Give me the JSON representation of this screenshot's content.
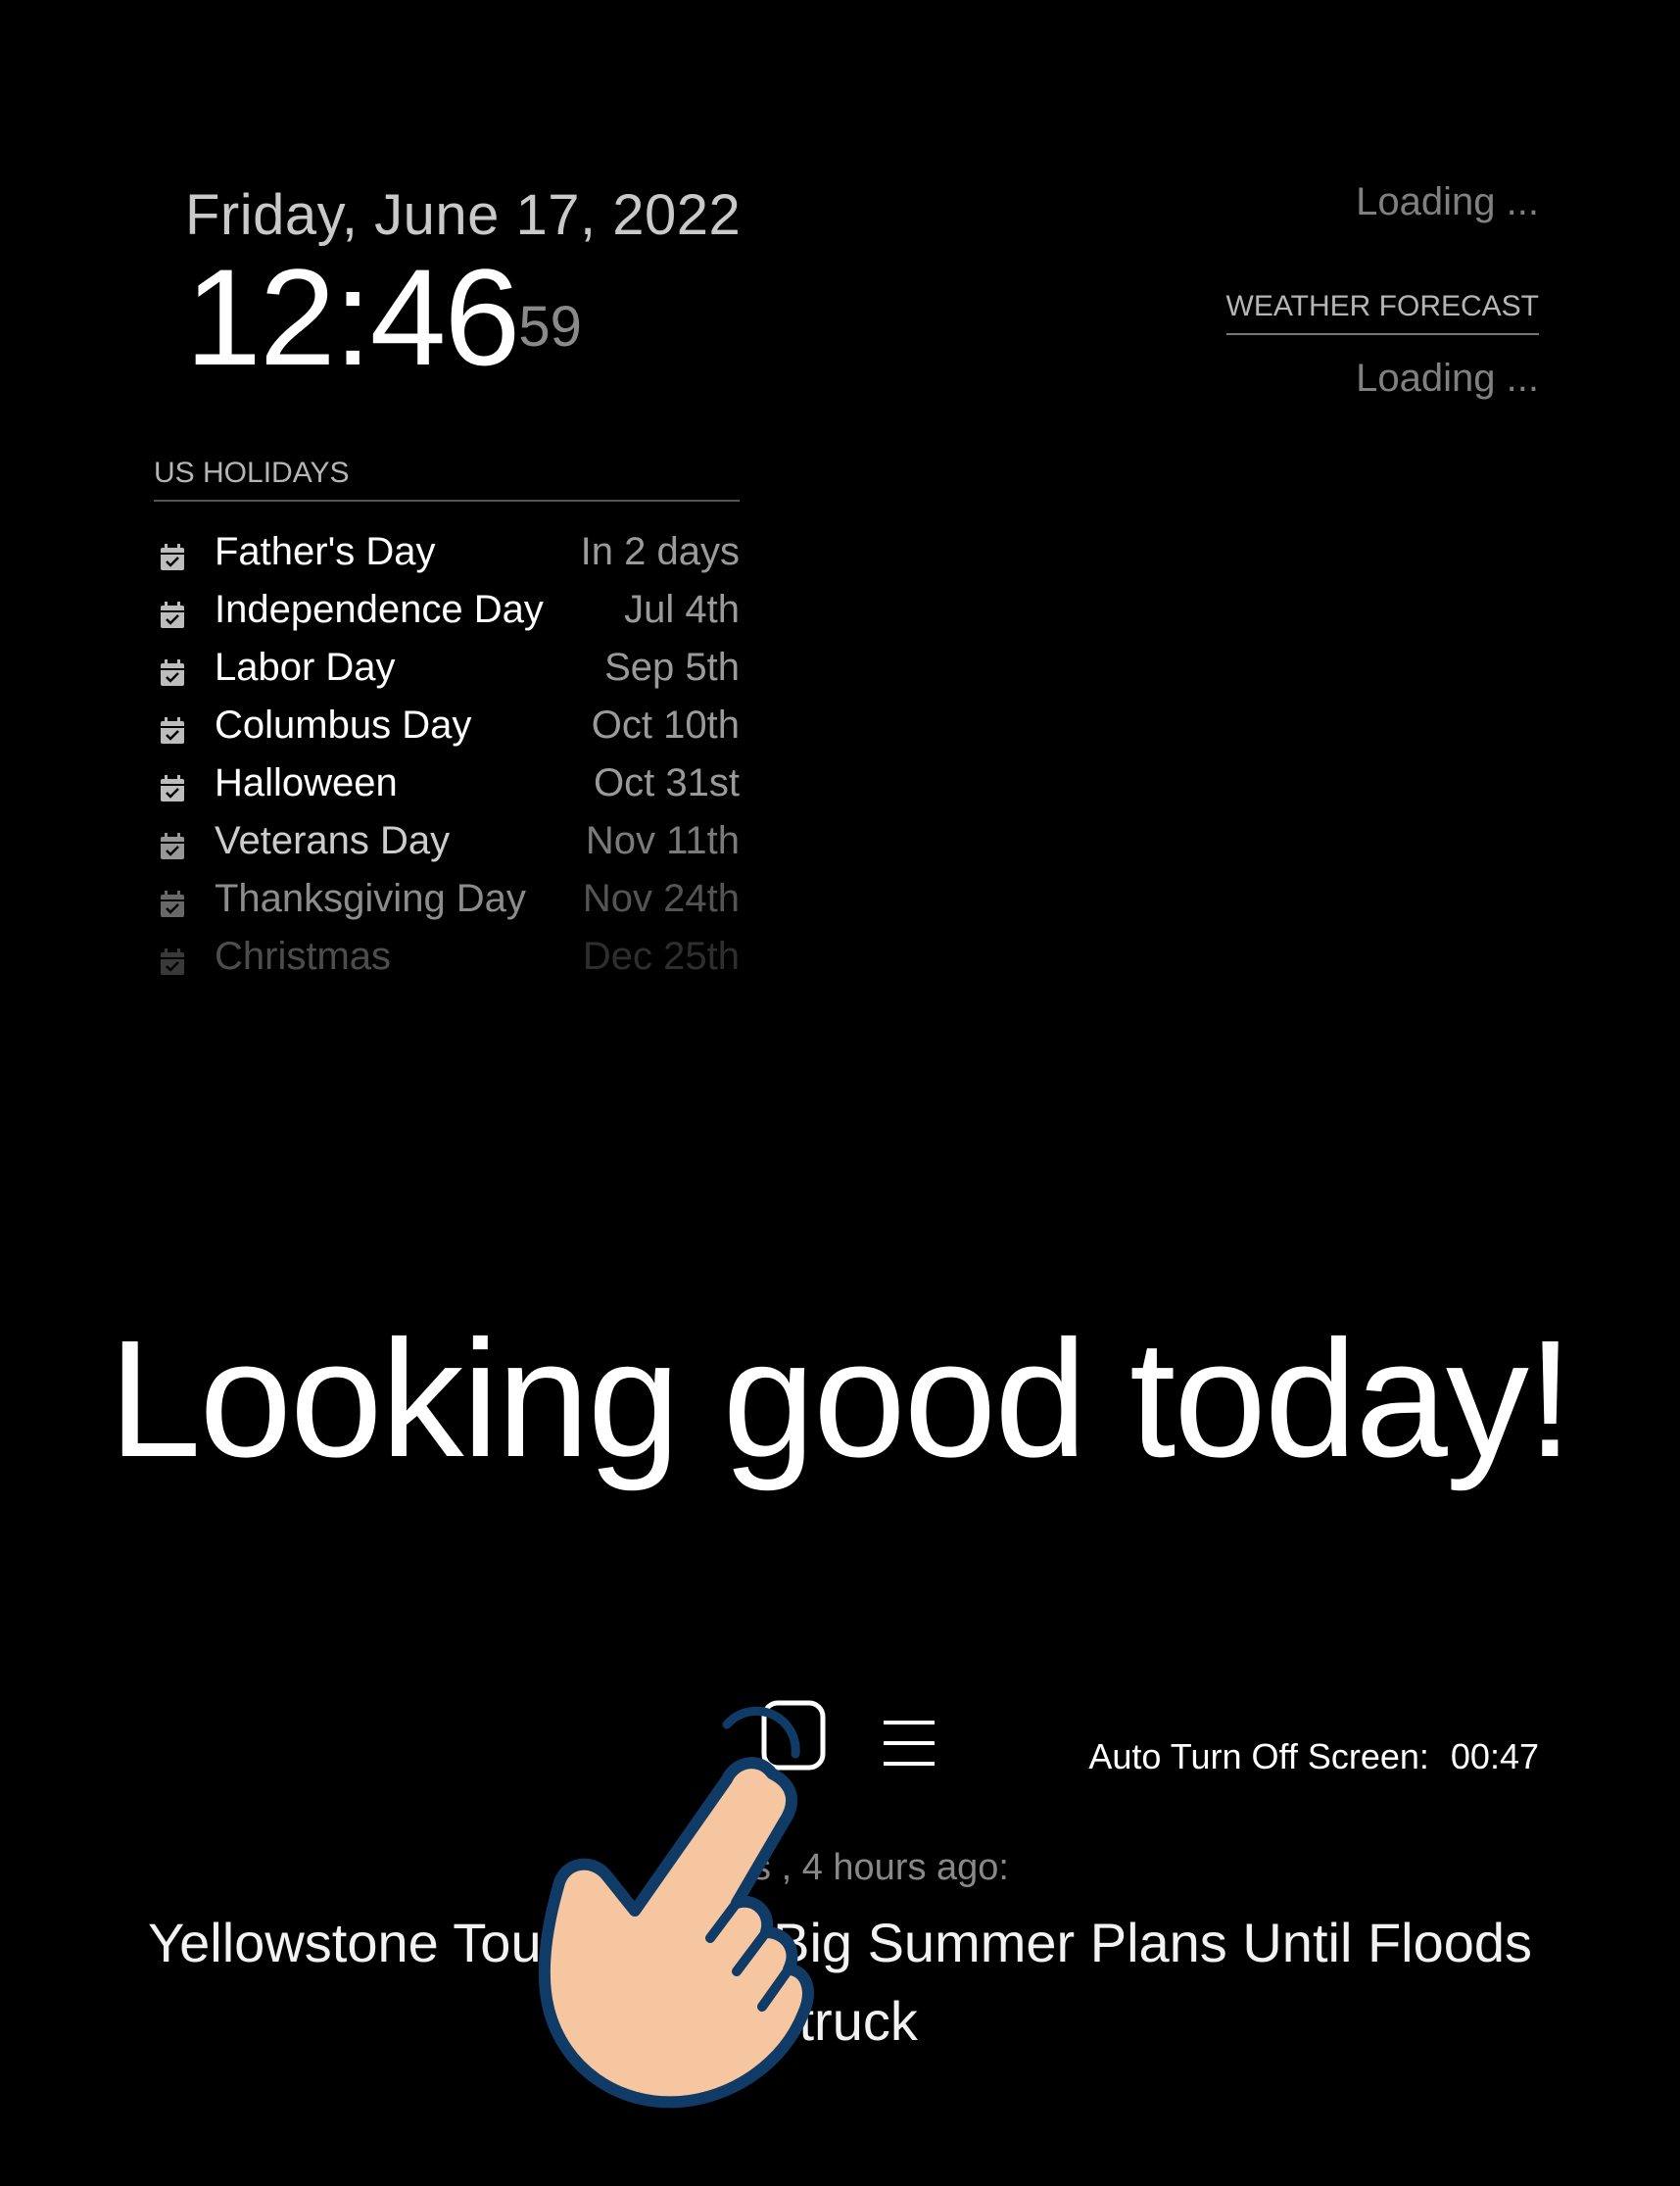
{
  "clock": {
    "date": "Friday, June 17, 2022",
    "time": "12:46",
    "seconds": "59"
  },
  "holidays": {
    "header": "US HOLIDAYS",
    "icon": "calendar-check-icon",
    "events": [
      {
        "title": "Father's Day",
        "time": "In 2 days"
      },
      {
        "title": "Independence Day",
        "time": "Jul 4th"
      },
      {
        "title": "Labor Day",
        "time": "Sep 5th"
      },
      {
        "title": "Columbus Day",
        "time": "Oct 10th"
      },
      {
        "title": "Halloween",
        "time": "Oct 31st"
      },
      {
        "title": "Veterans Day",
        "time": "Nov 11th"
      },
      {
        "title": "Thanksgiving Day",
        "time": "Nov 24th"
      },
      {
        "title": "Christmas",
        "time": "Dec 25th"
      }
    ]
  },
  "weather": {
    "current_status": "Loading ...",
    "forecast_header": "WEATHER FORECAST",
    "forecast_status": "Loading ..."
  },
  "compliment": "Looking good today!",
  "controls": {
    "screen_icon": "screen-toggle-icon",
    "menu_icon": "hamburger-menu-icon",
    "auto_off_label": "Auto Turn Off Screen:",
    "auto_off_time": "00:47"
  },
  "news": {
    "source": "Times , 4 hours ago:",
    "headline": "Yellowstone Tourists Had Big Summer Plans Until Floods Struck"
  },
  "colors": {
    "background": "#000000",
    "text_primary": "#ffffff",
    "text_dim": "#9a9a9a",
    "hand_fill": "#f5c6a0",
    "hand_outline": "#0f3b66"
  }
}
